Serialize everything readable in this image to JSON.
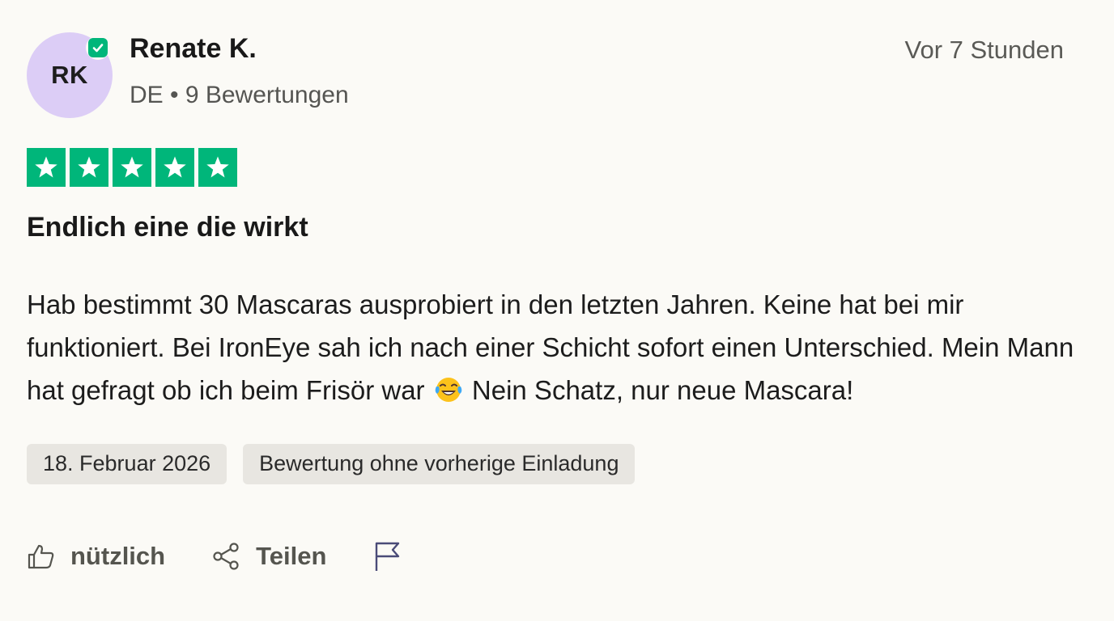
{
  "reviewer": {
    "initials": "RK",
    "name": "Renate K.",
    "meta": "DE • 9 Bewertungen",
    "verified_icon": "verified-check-icon",
    "avatar_color": "#dccdf6"
  },
  "timestamp": "Vor 7 Stunden",
  "rating": {
    "value": 5,
    "max": 5,
    "star_color": "#00b67a"
  },
  "review": {
    "title": "Endlich eine die wirkt",
    "body_before_emoji": "Hab bestimmt 30 Mascaras ausprobiert in den letzten Jahren. Keine hat bei mir funktioniert. Bei IronEye sah ich nach einer Schicht sofort einen Unterschied. Mein Mann hat gefragt ob ich beim Frisör war",
    "emoji": "tears-of-joy-emoji",
    "body_after_emoji": "Nein Schatz, nur neue Mascara!"
  },
  "tags": {
    "date": "18. Februar 2026",
    "invitation": "Bewertung ohne vorherige Einladung"
  },
  "actions": {
    "useful_label": "nützlich",
    "useful_icon": "thumbs-up-icon",
    "share_label": "Teilen",
    "share_icon": "share-icon",
    "flag_icon": "flag-icon"
  }
}
